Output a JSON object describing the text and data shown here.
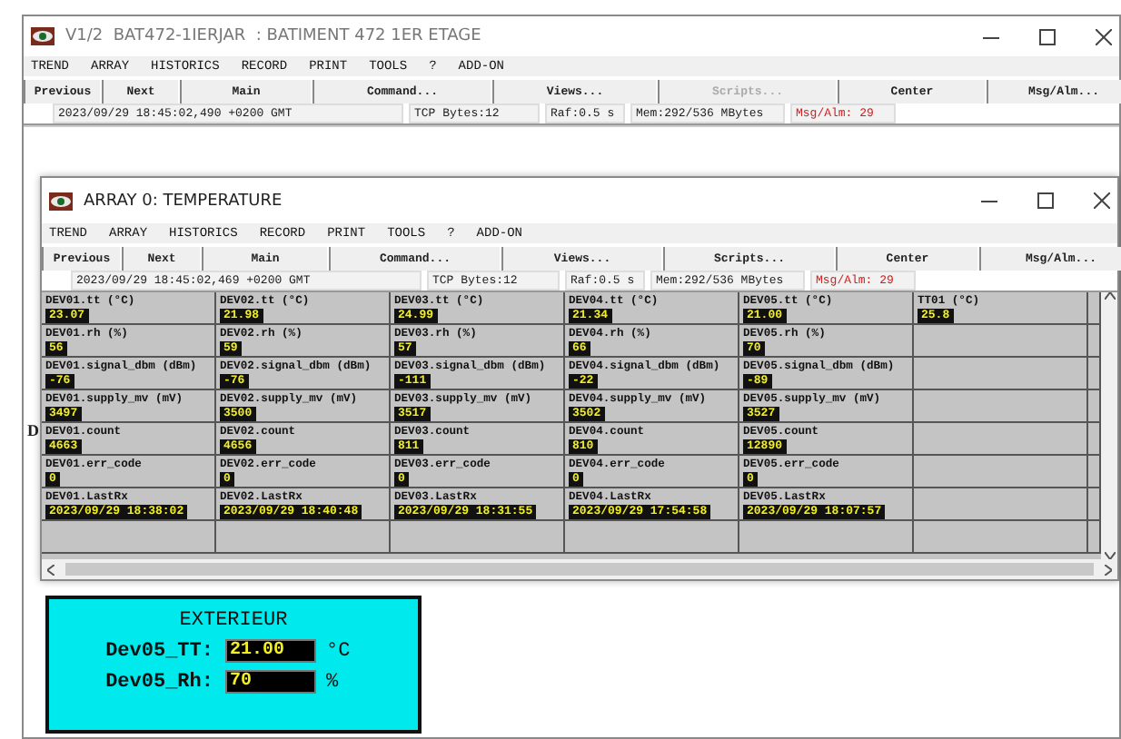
{
  "main_window": {
    "title": "V1/2  BAT472-1IERJAR  : BATIMENT 472 1ER ETAGE",
    "menu": [
      "TREND",
      "ARRAY",
      "HISTORICS",
      "RECORD",
      "PRINT",
      "TOOLS",
      "?",
      "ADD-ON"
    ],
    "toolbar": [
      {
        "label": "Previous",
        "disabled": false
      },
      {
        "label": "Next",
        "disabled": false
      },
      {
        "label": "Main",
        "disabled": false
      },
      {
        "label": "Command...",
        "disabled": false
      },
      {
        "label": "Views...",
        "disabled": false
      },
      {
        "label": "Scripts...",
        "disabled": true
      },
      {
        "label": "Center",
        "disabled": false
      },
      {
        "label": "Msg/Alm...",
        "disabled": false
      }
    ],
    "status": {
      "time": "2023/09/29 18:45:02,490 +0200 GMT",
      "tcp": "TCP Bytes:12",
      "raf": "Raf:0.5 s",
      "mem": "Mem:292/536 MBytes",
      "alarm": "Msg/Alm: 29"
    },
    "canvas_label": "D"
  },
  "array_window": {
    "title": "ARRAY 0: TEMPERATURE",
    "menu": [
      "TREND",
      "ARRAY",
      "HISTORICS",
      "RECORD",
      "PRINT",
      "TOOLS",
      "?",
      "ADD-ON"
    ],
    "toolbar": [
      {
        "label": "Previous",
        "disabled": false
      },
      {
        "label": "Next",
        "disabled": false
      },
      {
        "label": "Main",
        "disabled": false
      },
      {
        "label": "Command...",
        "disabled": false
      },
      {
        "label": "Views...",
        "disabled": false
      },
      {
        "label": "Scripts...",
        "disabled": false
      },
      {
        "label": "Center",
        "disabled": false
      },
      {
        "label": "Msg/Alm...",
        "disabled": false
      }
    ],
    "status": {
      "time": "2023/09/29 18:45:02,469 +0200 GMT",
      "tcp": "TCP Bytes:12",
      "raf": "Raf:0.5 s",
      "mem": "Mem:292/536 MBytes",
      "alarm": "Msg/Alm: 29"
    },
    "grid": [
      [
        {
          "label": "DEV01.tt (°C)",
          "value": "23.07"
        },
        {
          "label": "DEV02.tt (°C)",
          "value": "21.98"
        },
        {
          "label": "DEV03.tt (°C)",
          "value": "24.99"
        },
        {
          "label": "DEV04.tt (°C)",
          "value": "21.34"
        },
        {
          "label": "DEV05.tt (°C)",
          "value": "21.00"
        },
        {
          "label": "TT01 (°C)",
          "value": "25.8"
        }
      ],
      [
        {
          "label": "DEV01.rh (%)",
          "value": "56"
        },
        {
          "label": "DEV02.rh (%)",
          "value": "59"
        },
        {
          "label": "DEV03.rh (%)",
          "value": "57"
        },
        {
          "label": "DEV04.rh (%)",
          "value": "66"
        },
        {
          "label": "DEV05.rh (%)",
          "value": "70"
        }
      ],
      [
        {
          "label": "DEV01.signal_dbm (dBm)",
          "value": "-76"
        },
        {
          "label": "DEV02.signal_dbm (dBm)",
          "value": "-76"
        },
        {
          "label": "DEV03.signal_dbm (dBm)",
          "value": "-111"
        },
        {
          "label": "DEV04.signal_dbm (dBm)",
          "value": "-22"
        },
        {
          "label": "DEV05.signal_dbm (dBm)",
          "value": "-89"
        }
      ],
      [
        {
          "label": "DEV01.supply_mv (mV)",
          "value": "3497"
        },
        {
          "label": "DEV02.supply_mv (mV)",
          "value": "3500"
        },
        {
          "label": "DEV03.supply_mv (mV)",
          "value": "3517"
        },
        {
          "label": "DEV04.supply_mv (mV)",
          "value": "3502"
        },
        {
          "label": "DEV05.supply_mv (mV)",
          "value": "3527"
        }
      ],
      [
        {
          "label": "DEV01.count",
          "value": "4663"
        },
        {
          "label": "DEV02.count",
          "value": "4656"
        },
        {
          "label": "DEV03.count",
          "value": "811"
        },
        {
          "label": "DEV04.count",
          "value": "810"
        },
        {
          "label": "DEV05.count",
          "value": "12890"
        }
      ],
      [
        {
          "label": "DEV01.err_code",
          "value": "0"
        },
        {
          "label": "DEV02.err_code",
          "value": "0"
        },
        {
          "label": "DEV03.err_code",
          "value": "0"
        },
        {
          "label": "DEV04.err_code",
          "value": "0"
        },
        {
          "label": "DEV05.err_code",
          "value": "0"
        }
      ],
      [
        {
          "label": "DEV01.LastRx",
          "value": "2023/09/29 18:38:02"
        },
        {
          "label": "DEV02.LastRx",
          "value": "2023/09/29 18:40:48"
        },
        {
          "label": "DEV03.LastRx",
          "value": "2023/09/29 18:31:55"
        },
        {
          "label": "DEV04.LastRx",
          "value": "2023/09/29 17:54:58"
        },
        {
          "label": "DEV05.LastRx",
          "value": "2023/09/29 18:07:57"
        }
      ]
    ]
  },
  "panel": {
    "title": "EXTERIEUR",
    "rows": [
      {
        "label": "Dev05_TT:",
        "value": "21.00",
        "unit": "°C"
      },
      {
        "label": "Dev05_Rh:",
        "value": "70",
        "unit": "%"
      }
    ]
  }
}
